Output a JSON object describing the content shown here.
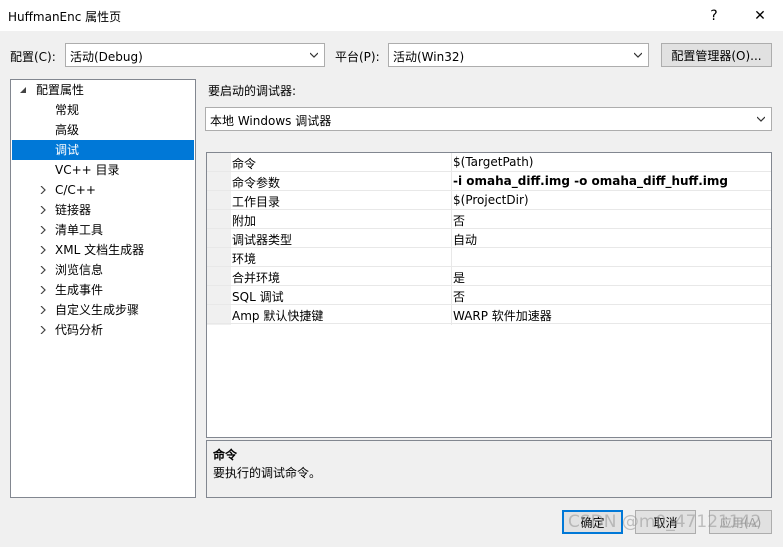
{
  "window": {
    "title": "HuffmanEnc 属性页",
    "help_glyph": "?",
    "close_glyph": "✕"
  },
  "config": {
    "label": "配置(C):",
    "value": "活动(Debug)",
    "platform_label": "平台(P):",
    "platform_value": "活动(Win32)",
    "manager_button": "配置管理器(O)..."
  },
  "tree": {
    "root": {
      "label": "配置属性",
      "expanded": true
    },
    "items": [
      {
        "label": "常规",
        "expandable": false,
        "selected": false
      },
      {
        "label": "高级",
        "expandable": false,
        "selected": false
      },
      {
        "label": "调试",
        "expandable": false,
        "selected": true
      },
      {
        "label": "VC++ 目录",
        "expandable": false,
        "selected": false
      },
      {
        "label": "C/C++",
        "expandable": true,
        "selected": false
      },
      {
        "label": "链接器",
        "expandable": true,
        "selected": false
      },
      {
        "label": "清单工具",
        "expandable": true,
        "selected": false
      },
      {
        "label": "XML 文档生成器",
        "expandable": true,
        "selected": false
      },
      {
        "label": "浏览信息",
        "expandable": true,
        "selected": false
      },
      {
        "label": "生成事件",
        "expandable": true,
        "selected": false
      },
      {
        "label": "自定义生成步骤",
        "expandable": true,
        "selected": false
      },
      {
        "label": "代码分析",
        "expandable": true,
        "selected": false
      }
    ]
  },
  "debugger": {
    "label": "要启动的调试器:",
    "value": "本地 Windows 调试器"
  },
  "grid": {
    "rows": [
      {
        "name": "命令",
        "value": "$(TargetPath)",
        "bold": false
      },
      {
        "name": "命令参数",
        "value": "-i omaha_diff.img -o omaha_diff_huff.img",
        "bold": true
      },
      {
        "name": "工作目录",
        "value": "$(ProjectDir)",
        "bold": false
      },
      {
        "name": "附加",
        "value": "否",
        "bold": false
      },
      {
        "name": "调试器类型",
        "value": "自动",
        "bold": false
      },
      {
        "name": "环境",
        "value": "",
        "bold": false
      },
      {
        "name": "合并环境",
        "value": "是",
        "bold": false
      },
      {
        "name": "SQL 调试",
        "value": "否",
        "bold": false
      },
      {
        "name": "Amp 默认快捷键",
        "value": "WARP 软件加速器",
        "bold": false
      }
    ]
  },
  "description": {
    "title": "命令",
    "text": "要执行的调试命令。"
  },
  "buttons": {
    "ok": "确定",
    "cancel": "取消",
    "apply": "应用(A)"
  },
  "watermark": "CSDN @m0_47121142",
  "colors": {
    "selection": "#0078d7",
    "dialog_bg": "#f0f0f0"
  }
}
